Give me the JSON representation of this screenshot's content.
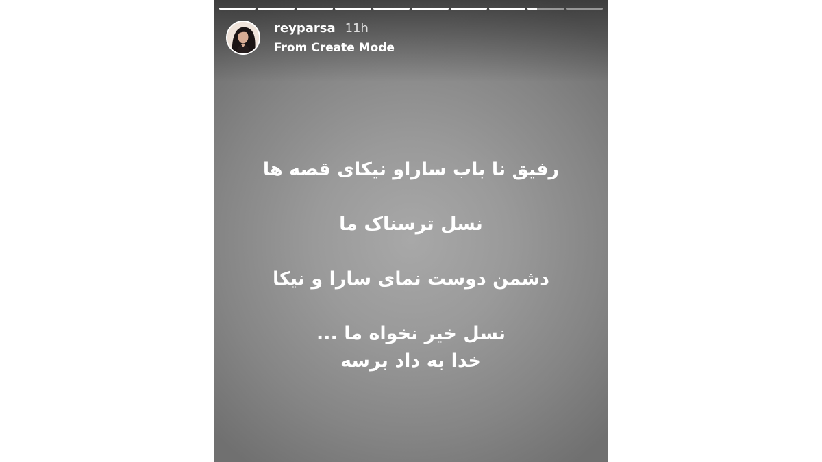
{
  "story": {
    "progress": [
      1,
      1,
      1,
      1,
      1,
      1,
      1,
      1,
      0.25,
      0
    ],
    "username": "reyparsa",
    "time_ago": "11h",
    "source": "From Create Mode",
    "lines": [
      "رفیق نا باب ساراو نیکای قصه ها",
      "نسل ترسناک ما",
      "دشمن دوست نمای سارا و نیکا",
      "نسل خیر نخواه ما ...",
      "خدا به داد برسه"
    ]
  },
  "colors": {
    "text": "#ffffff",
    "background": "#9a9a9a"
  },
  "icons": {
    "avatar": "profile-avatar"
  }
}
